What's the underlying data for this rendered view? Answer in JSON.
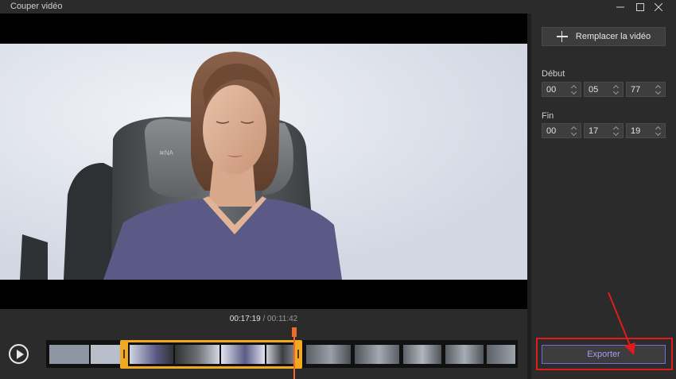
{
  "window": {
    "title": "Couper vidéo"
  },
  "right_panel": {
    "replace_label": "Remplacer la vidéo",
    "start_label": "Début",
    "start": {
      "hh": "00",
      "mm": "05",
      "ss": "77"
    },
    "end_label": "Fin",
    "end": {
      "hh": "00",
      "mm": "17",
      "ss": "19"
    },
    "export_label": "Exporter"
  },
  "timeline": {
    "current_time": "00:17:19",
    "separator": "/",
    "total_time": "00:11:42"
  },
  "colors": {
    "accent_selection": "#f2a91d",
    "playhead": "#f06a2a",
    "export_text": "#a89bf3",
    "annotation": "#e01b1b"
  }
}
